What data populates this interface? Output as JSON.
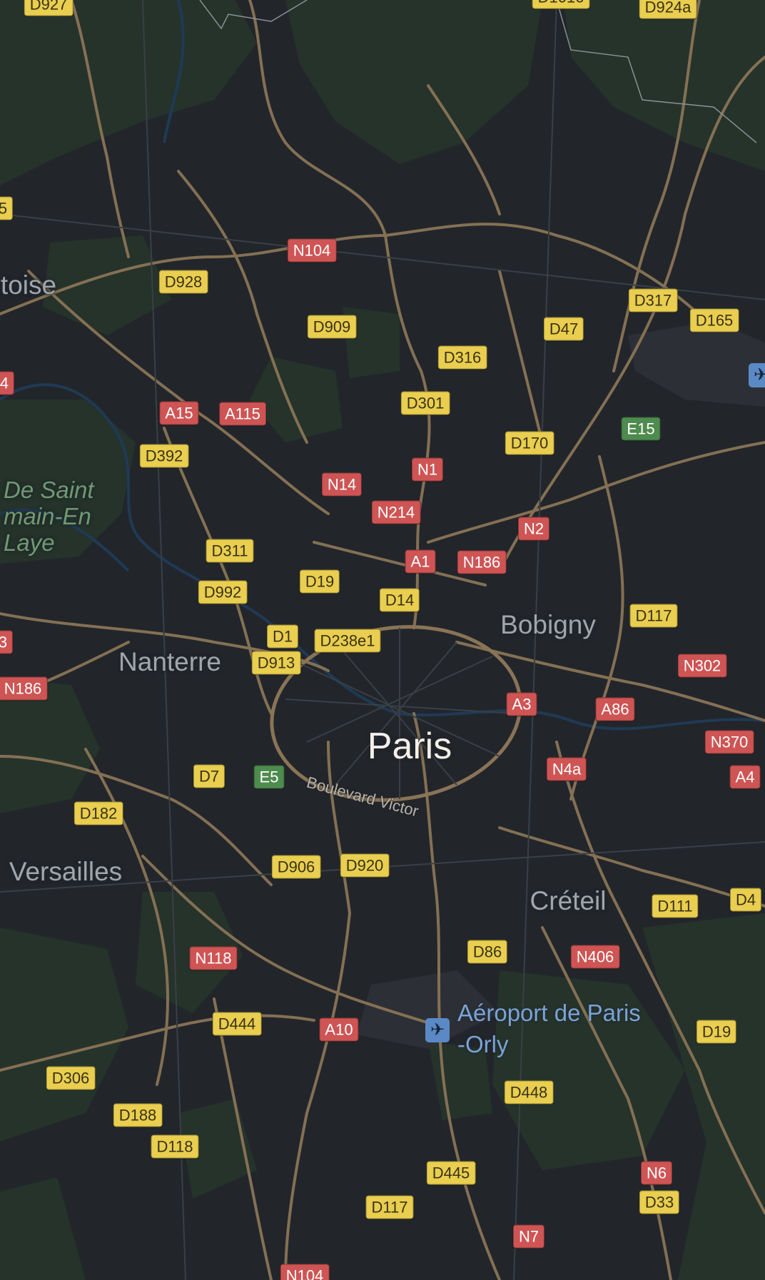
{
  "map": {
    "city": "Paris",
    "places": [
      {
        "id": "bobigny",
        "name": "Bobigny"
      },
      {
        "id": "nanterre",
        "name": "Nanterre"
      },
      {
        "id": "creteil",
        "name": "Créteil"
      },
      {
        "id": "versailles",
        "name": "Versailles"
      },
      {
        "id": "pontoise",
        "name": "toise"
      }
    ],
    "park": {
      "lines": [
        "De Saint",
        "main-En",
        "Laye"
      ]
    },
    "street": "Boulevard Victor",
    "airport": {
      "name_line1": "Aéroport de Paris",
      "name_line2": "-Orly",
      "icon": "airplane-icon"
    },
    "road_shields": [
      {
        "id": "D927",
        "label": "D927",
        "type": "d"
      },
      {
        "id": "D924a",
        "label": "D924a",
        "type": "d"
      },
      {
        "id": "D1016",
        "label": "D1016",
        "type": "d"
      },
      {
        "id": "N104n",
        "label": "N104",
        "type": "n"
      },
      {
        "id": "D928",
        "label": "D928",
        "type": "d"
      },
      {
        "id": "D909",
        "label": "D909",
        "type": "d"
      },
      {
        "id": "D317",
        "label": "D317",
        "type": "d"
      },
      {
        "id": "D165",
        "label": "D165",
        "type": "d"
      },
      {
        "id": "D47",
        "label": "D47",
        "type": "d"
      },
      {
        "id": "D316",
        "label": "D316",
        "type": "d"
      },
      {
        "id": "D301",
        "label": "D301",
        "type": "d"
      },
      {
        "id": "A15",
        "label": "A15",
        "type": "a"
      },
      {
        "id": "A115",
        "label": "A115",
        "type": "a"
      },
      {
        "id": "E15",
        "label": "E15",
        "type": "e"
      },
      {
        "id": "D392",
        "label": "D392",
        "type": "d"
      },
      {
        "id": "D170",
        "label": "D170",
        "type": "d"
      },
      {
        "id": "N1",
        "label": "N1",
        "type": "n"
      },
      {
        "id": "N14",
        "label": "N14",
        "type": "n"
      },
      {
        "id": "N214",
        "label": "N214",
        "type": "n"
      },
      {
        "id": "N2",
        "label": "N2",
        "type": "n"
      },
      {
        "id": "D311",
        "label": "D311",
        "type": "d"
      },
      {
        "id": "A1",
        "label": "A1",
        "type": "a"
      },
      {
        "id": "N186e",
        "label": "N186",
        "type": "n"
      },
      {
        "id": "D992",
        "label": "D992",
        "type": "d"
      },
      {
        "id": "D19n",
        "label": "D19",
        "type": "d"
      },
      {
        "id": "D14",
        "label": "D14",
        "type": "d"
      },
      {
        "id": "D117n",
        "label": "D117",
        "type": "d"
      },
      {
        "id": "D1",
        "label": "D1",
        "type": "d"
      },
      {
        "id": "D238e1",
        "label": "D238e1",
        "type": "d"
      },
      {
        "id": "D913",
        "label": "D913",
        "type": "d"
      },
      {
        "id": "N302",
        "label": "N302",
        "type": "n"
      },
      {
        "id": "N186w",
        "label": "N186",
        "type": "n"
      },
      {
        "id": "A3",
        "label": "A3",
        "type": "a"
      },
      {
        "id": "A86",
        "label": "A86",
        "type": "a"
      },
      {
        "id": "N370",
        "label": "N370",
        "type": "n"
      },
      {
        "id": "A4",
        "label": "A4",
        "type": "a"
      },
      {
        "id": "D7",
        "label": "D7",
        "type": "d"
      },
      {
        "id": "E5",
        "label": "E5",
        "type": "e"
      },
      {
        "id": "N4a",
        "label": "N4a",
        "type": "n"
      },
      {
        "id": "D182",
        "label": "D182",
        "type": "d"
      },
      {
        "id": "D906",
        "label": "D906",
        "type": "d"
      },
      {
        "id": "D920",
        "label": "D920",
        "type": "d"
      },
      {
        "id": "D4",
        "label": "D4",
        "type": "d"
      },
      {
        "id": "D111",
        "label": "D111",
        "type": "d"
      },
      {
        "id": "N118",
        "label": "N118",
        "type": "n"
      },
      {
        "id": "D86",
        "label": "D86",
        "type": "d"
      },
      {
        "id": "N406",
        "label": "N406",
        "type": "n"
      },
      {
        "id": "D444",
        "label": "D444",
        "type": "d"
      },
      {
        "id": "A10",
        "label": "A10",
        "type": "a"
      },
      {
        "id": "D19s",
        "label": "D19",
        "type": "d"
      },
      {
        "id": "D306",
        "label": "D306",
        "type": "d"
      },
      {
        "id": "D448",
        "label": "D448",
        "type": "d"
      },
      {
        "id": "D188",
        "label": "D188",
        "type": "d"
      },
      {
        "id": "D118",
        "label": "D118",
        "type": "d"
      },
      {
        "id": "D445",
        "label": "D445",
        "type": "d"
      },
      {
        "id": "N6",
        "label": "N6",
        "type": "n"
      },
      {
        "id": "D117s",
        "label": "D117",
        "type": "d"
      },
      {
        "id": "D33",
        "label": "D33",
        "type": "d"
      },
      {
        "id": "N7",
        "label": "N7",
        "type": "n"
      },
      {
        "id": "N104s",
        "label": "N104",
        "type": "n"
      },
      {
        "id": "edge3",
        "label": "3",
        "type": "n"
      },
      {
        "id": "edge4",
        "label": "4",
        "type": "n"
      },
      {
        "id": "edge5",
        "label": "5",
        "type": "d"
      }
    ]
  },
  "colors": {
    "background": "#22262b",
    "green_area": "#26342b",
    "road": "#8a7456",
    "water": "#1f3a55",
    "d_shield": "#e9ce4f",
    "n_shield": "#cf5454",
    "e_shield": "#4e8b4e",
    "airport": "#5b89c6"
  }
}
